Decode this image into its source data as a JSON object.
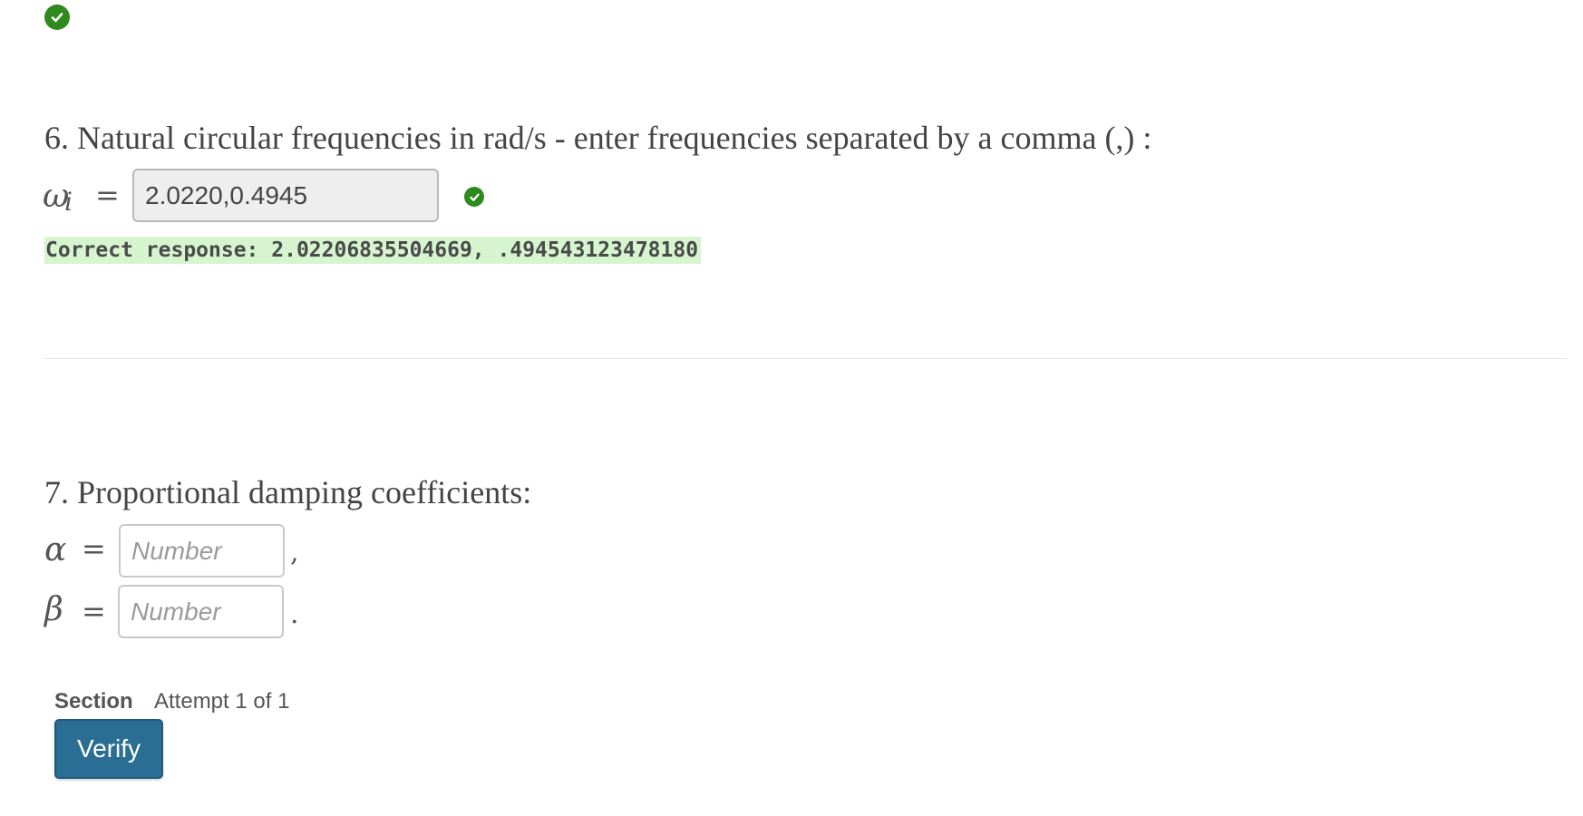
{
  "colors": {
    "success": "#2f8a1e",
    "correct_highlight": "#d6f5cf",
    "verify_button": "#2a6f93"
  },
  "icons": {
    "top_status": "check-circle-icon",
    "q6_status": "check-circle-icon"
  },
  "question6": {
    "title": "6. Natural circular frequencies in rad/s - enter frequencies separated by a comma (,) :",
    "var_symbol": "ω",
    "var_subscript": "i",
    "equals": "=",
    "input_value": "2.0220,0.4945",
    "correct_response": "Correct response: 2.02206835504669, .494543123478180"
  },
  "question7": {
    "title": "7. Proportional damping coefficients:",
    "alpha": {
      "symbol": "α",
      "equals": "=",
      "placeholder": "Number",
      "trailing": ","
    },
    "beta": {
      "symbol": "β",
      "equals": "=",
      "placeholder": "Number",
      "trailing": "."
    }
  },
  "footer": {
    "section_label": "Section",
    "attempt_text": "Attempt 1 of 1",
    "verify_label": "Verify"
  }
}
